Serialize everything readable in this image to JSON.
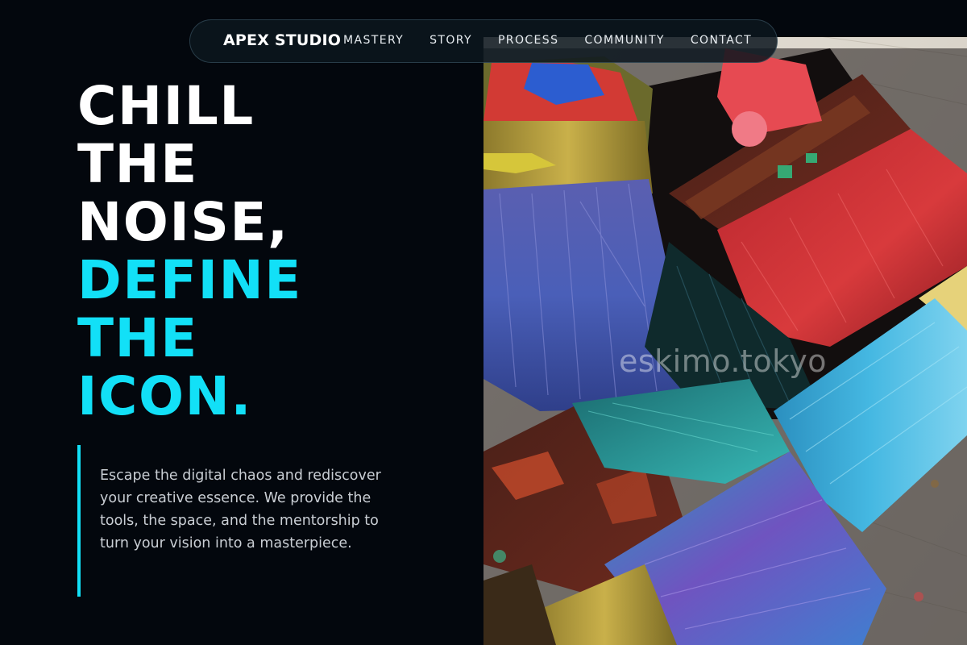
{
  "nav": {
    "brand": "APEX STUDIO",
    "links": [
      "MASTERY",
      "STORY",
      "PROCESS",
      "COMMUNITY",
      "CONTACT"
    ]
  },
  "hero": {
    "lines_white": [
      "CHILL",
      "THE",
      "NOISE,"
    ],
    "lines_accent": [
      "DEFINE",
      "THE",
      "ICON."
    ]
  },
  "description": "Escape the digital chaos and rediscover your creative essence. We provide the tools, the space, and the mentorship to turn your vision into a masterpiece.",
  "image": {
    "subject": "paint-brushes-photo",
    "watermark": "eskimo.tokyo"
  },
  "colors": {
    "background": "#03070d",
    "accent": "#12e0f7",
    "text_primary": "#ffffff",
    "text_muted": "#c9ced4"
  }
}
